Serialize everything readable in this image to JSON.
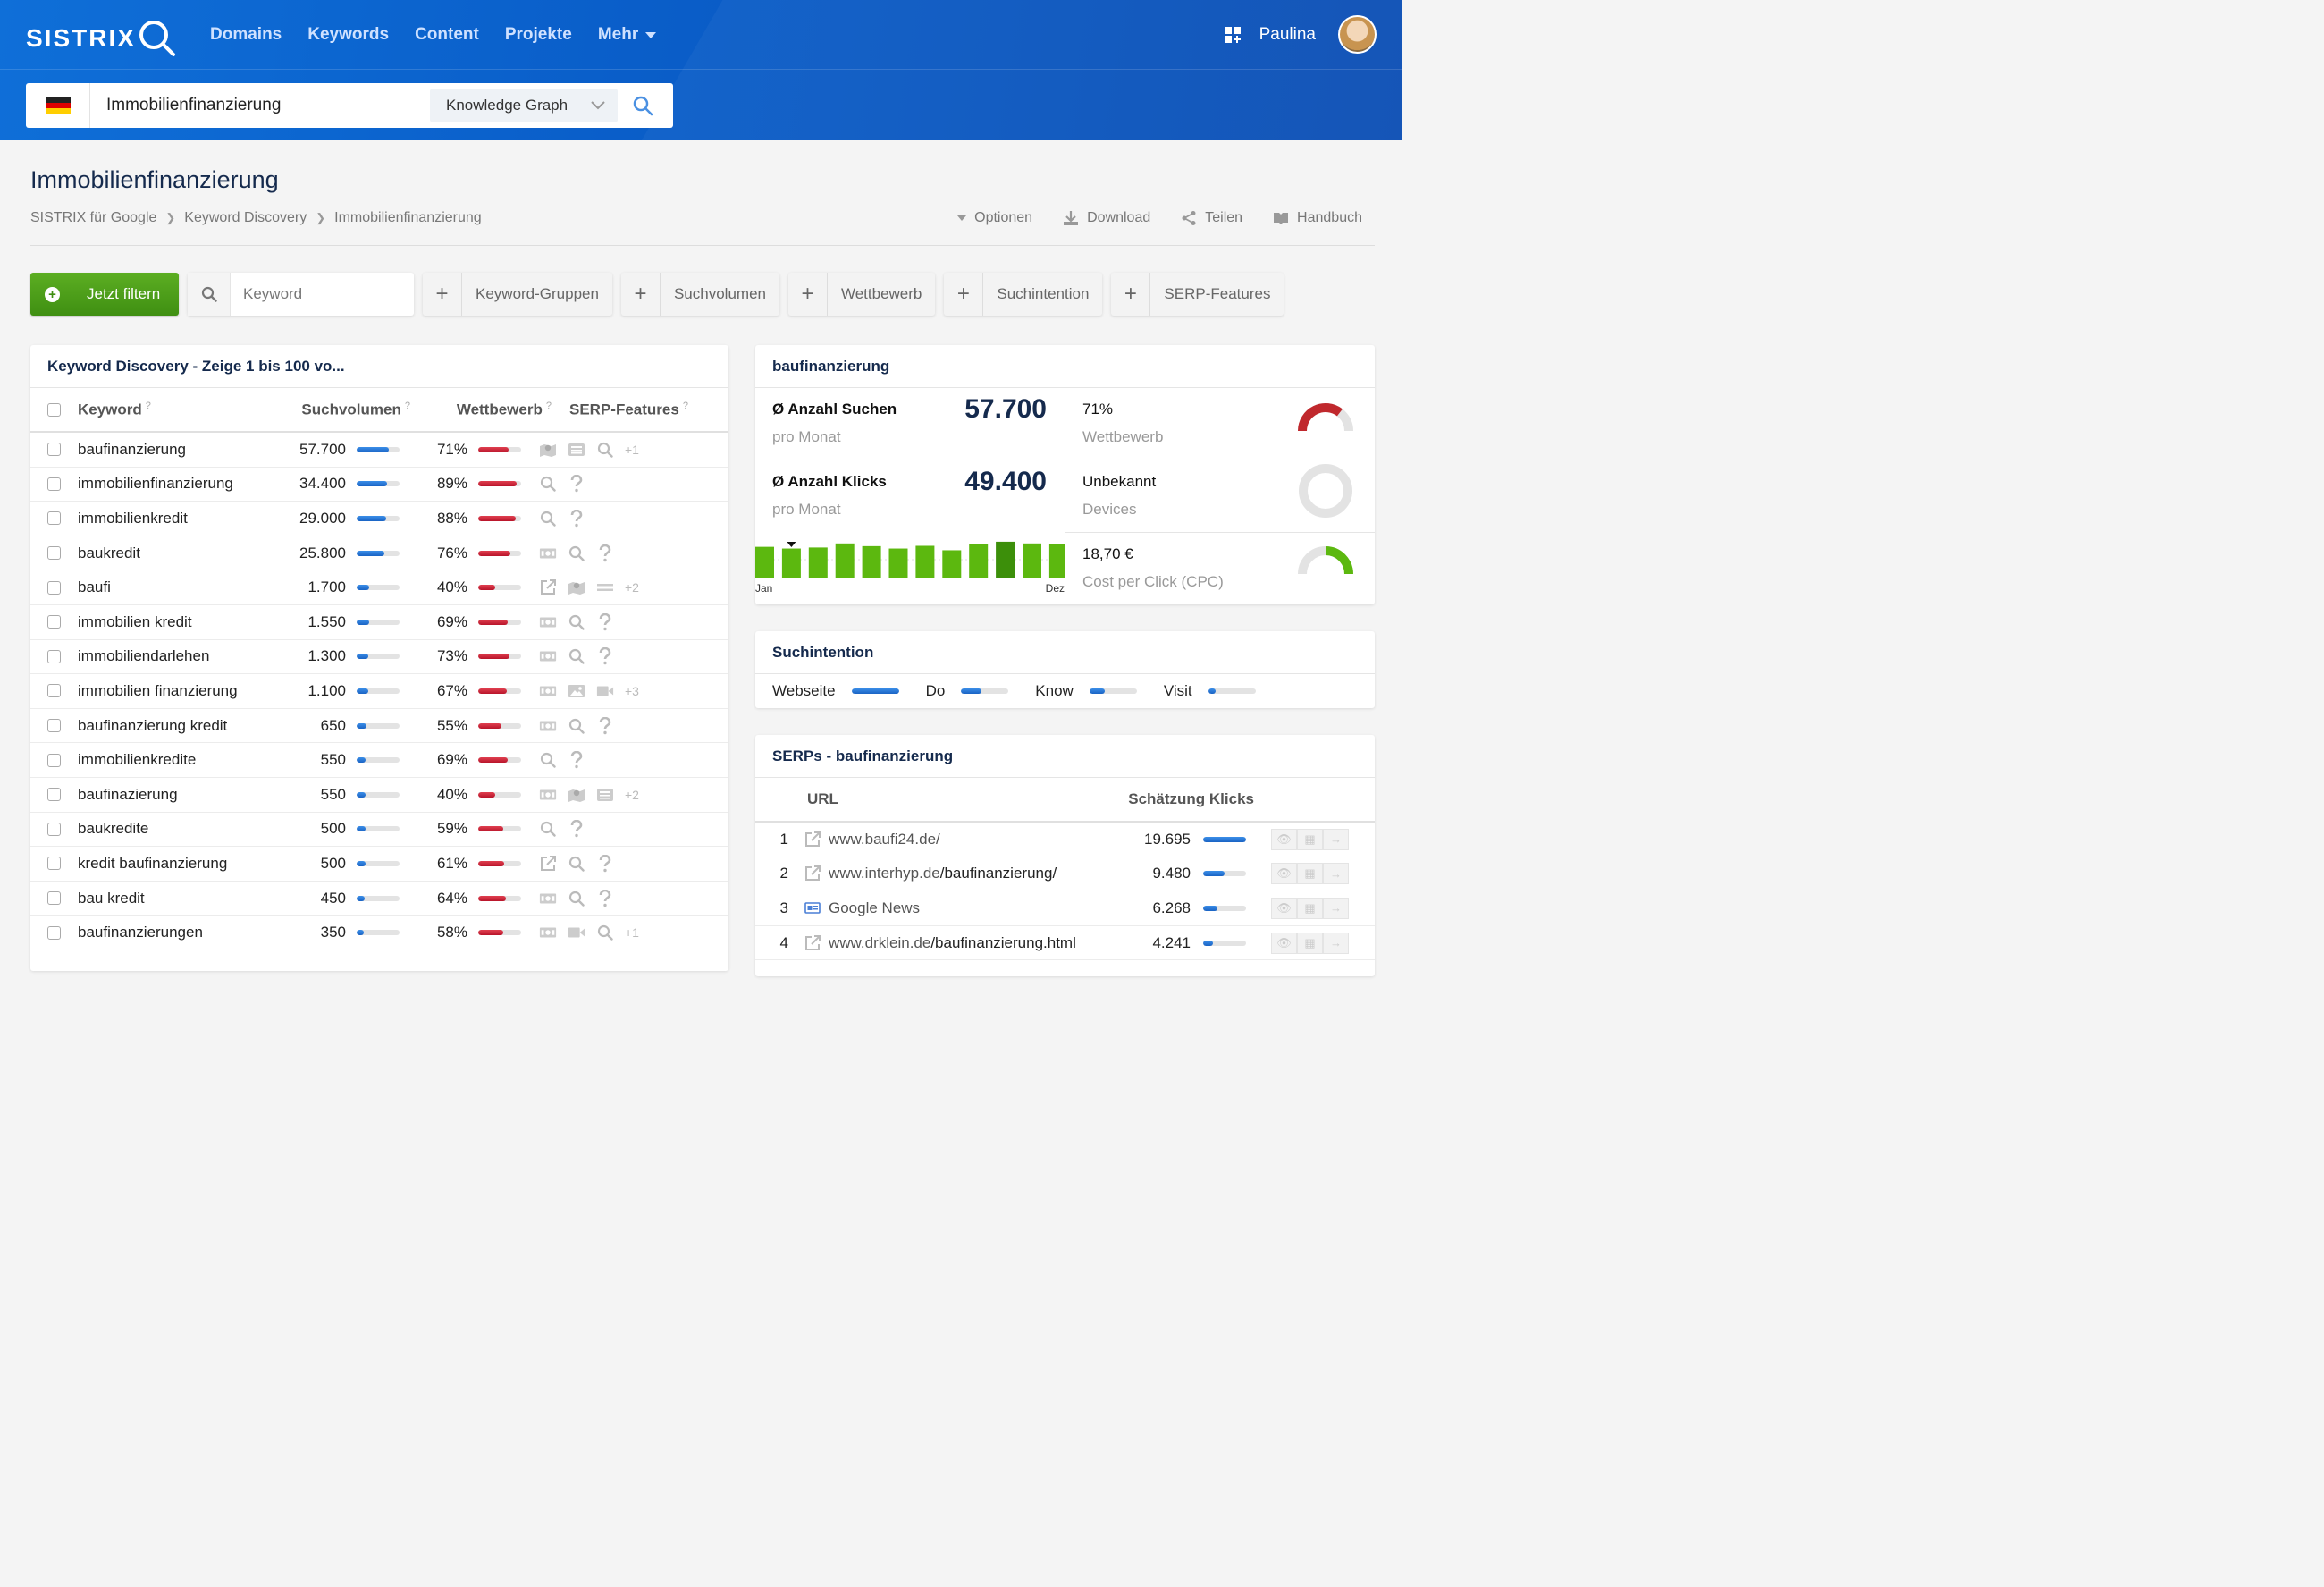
{
  "header": {
    "logo": "SISTRIX",
    "nav": [
      "Domains",
      "Keywords",
      "Content",
      "Projekte"
    ],
    "nav_more": "Mehr",
    "user": "Paulina"
  },
  "search": {
    "value": "Immobilienfinanzierung",
    "mode": "Knowledge Graph"
  },
  "page": {
    "title": "Immobilienfinanzierung",
    "breadcrumb": [
      "SISTRIX für Google",
      "Keyword Discovery",
      "Immobilienfinanzierung"
    ],
    "actions": {
      "options": "Optionen",
      "download": "Download",
      "share": "Teilen",
      "manual": "Handbuch"
    }
  },
  "filters": {
    "main": "Jetzt filtern",
    "keyword_placeholder": "Keyword",
    "chips": [
      "Keyword-Gruppen",
      "Suchvolumen",
      "Wettbewerb",
      "Suchintention",
      "SERP-Features"
    ]
  },
  "table": {
    "title": "Keyword Discovery - Zeige 1 bis 100 vo...",
    "headers": {
      "keyword": "Keyword",
      "volume": "Suchvolumen",
      "competition": "Wettbewerb",
      "serp": "SERP-Features"
    },
    "help": "?",
    "rows": [
      {
        "keyword": "baufinanzierung",
        "volume": "57.700",
        "vol_pct": 0.75,
        "competition": "71%",
        "comp_pct": 0.71,
        "serp": [
          "map-icon",
          "news-icon",
          "search-icon"
        ],
        "more": "+1"
      },
      {
        "keyword": "immobilienfinanzierung",
        "volume": "34.400",
        "vol_pct": 0.7,
        "competition": "89%",
        "comp_pct": 0.89,
        "serp": [
          "search-icon",
          "question-icon"
        ],
        "more": ""
      },
      {
        "keyword": "immobilienkredit",
        "volume": "29.000",
        "vol_pct": 0.68,
        "competition": "88%",
        "comp_pct": 0.88,
        "serp": [
          "search-icon",
          "question-icon"
        ],
        "more": ""
      },
      {
        "keyword": "baukredit",
        "volume": "25.800",
        "vol_pct": 0.65,
        "competition": "76%",
        "comp_pct": 0.76,
        "serp": [
          "ads-icon",
          "search-icon",
          "question-icon"
        ],
        "more": ""
      },
      {
        "keyword": "baufi",
        "volume": "1.700",
        "vol_pct": 0.3,
        "competition": "40%",
        "comp_pct": 0.4,
        "serp": [
          "external-link-icon",
          "map-icon",
          "equals-icon"
        ],
        "more": "+2"
      },
      {
        "keyword": "immobilien kredit",
        "volume": "1.550",
        "vol_pct": 0.3,
        "competition": "69%",
        "comp_pct": 0.69,
        "serp": [
          "ads-icon",
          "search-icon",
          "question-icon"
        ],
        "more": ""
      },
      {
        "keyword": "immobiliendarlehen",
        "volume": "1.300",
        "vol_pct": 0.28,
        "competition": "73%",
        "comp_pct": 0.73,
        "serp": [
          "ads-icon",
          "search-icon",
          "question-icon"
        ],
        "more": ""
      },
      {
        "keyword": "immobilien finanzierung",
        "volume": "1.100",
        "vol_pct": 0.27,
        "competition": "67%",
        "comp_pct": 0.67,
        "serp": [
          "ads-icon",
          "image-icon",
          "video-icon"
        ],
        "more": "+3"
      },
      {
        "keyword": "baufinanzierung kredit",
        "volume": "650",
        "vol_pct": 0.22,
        "competition": "55%",
        "comp_pct": 0.55,
        "serp": [
          "ads-icon",
          "search-icon",
          "question-icon"
        ],
        "more": ""
      },
      {
        "keyword": "immobilienkredite",
        "volume": "550",
        "vol_pct": 0.2,
        "competition": "69%",
        "comp_pct": 0.69,
        "serp": [
          "search-icon",
          "question-icon"
        ],
        "more": ""
      },
      {
        "keyword": "baufinazierung",
        "volume": "550",
        "vol_pct": 0.2,
        "competition": "40%",
        "comp_pct": 0.4,
        "serp": [
          "ads-icon",
          "map-icon",
          "news-icon"
        ],
        "more": "+2"
      },
      {
        "keyword": "baukredite",
        "volume": "500",
        "vol_pct": 0.2,
        "competition": "59%",
        "comp_pct": 0.59,
        "serp": [
          "search-icon",
          "question-icon"
        ],
        "more": ""
      },
      {
        "keyword": "kredit baufinanzierung",
        "volume": "500",
        "vol_pct": 0.2,
        "competition": "61%",
        "comp_pct": 0.61,
        "serp": [
          "external-link-icon",
          "search-icon",
          "question-icon"
        ],
        "more": ""
      },
      {
        "keyword": "bau kredit",
        "volume": "450",
        "vol_pct": 0.18,
        "competition": "64%",
        "comp_pct": 0.64,
        "serp": [
          "ads-icon",
          "search-icon",
          "question-icon"
        ],
        "more": ""
      },
      {
        "keyword": "baufinanzierungen",
        "volume": "350",
        "vol_pct": 0.16,
        "competition": "58%",
        "comp_pct": 0.58,
        "serp": [
          "ads-icon",
          "video-icon",
          "search-icon"
        ],
        "more": "+1"
      }
    ]
  },
  "detail": {
    "title": "baufinanzierung",
    "searches_label": "Ø Anzahl Suchen",
    "searches_sub": "pro Monat",
    "searches_value": "57.700",
    "clicks_label": "Ø Anzahl Klicks",
    "clicks_sub": "pro Monat",
    "clicks_value": "49.400",
    "competition_value": "71%",
    "competition_label": "Wettbewerb",
    "competition_level": 0.71,
    "devices_value": "Unbekannt",
    "devices_label": "Devices",
    "cpc_value": "18,70 €",
    "cpc_label": "Cost per Click (CPC)",
    "cpc_level": 0.5,
    "trend_start": "Jan",
    "trend_end": "Dez",
    "colors": {
      "bar": "#5cb80f",
      "bar_dark": "#3c8f0a",
      "gauge_red": "#c0282d",
      "gauge_green": "#5cb80f"
    }
  },
  "chart_data": {
    "type": "bar",
    "categories": [
      "Jan",
      "",
      "",
      "",
      "",
      "",
      "",
      "",
      "",
      "",
      "",
      "Dez"
    ],
    "values": [
      0.9,
      0.85,
      0.88,
      1.0,
      0.92,
      0.85,
      0.93,
      0.8,
      0.98,
      1.05,
      1.0,
      0.97
    ],
    "highlight_index": 9,
    "marker_index": 1
  },
  "intent": {
    "title": "Suchintention",
    "items": [
      {
        "label": "Webseite",
        "pct": 1.0
      },
      {
        "label": "Do",
        "pct": 0.42
      },
      {
        "label": "Know",
        "pct": 0.33
      },
      {
        "label": "Visit",
        "pct": 0.15
      }
    ]
  },
  "serps": {
    "title": "SERPs - baufinanzierung",
    "headers": {
      "url": "URL",
      "clicks": "Schätzung Klicks"
    },
    "rows": [
      {
        "pos": "1",
        "domain": "www.baufi24.de/",
        "path": "",
        "icon": "external-link-icon",
        "clicks": "19.695",
        "pct": 1.0
      },
      {
        "pos": "2",
        "domain": "www.interhyp.de",
        "path": "/baufinanzierung/",
        "icon": "external-link-icon",
        "clicks": "9.480",
        "pct": 0.5
      },
      {
        "pos": "3",
        "domain": "Google News",
        "path": "",
        "icon": "google-news-icon",
        "clicks": "6.268",
        "pct": 0.33
      },
      {
        "pos": "4",
        "domain": "www.drklein.de",
        "path": "/baufinanzierung.html",
        "icon": "external-link-icon",
        "clicks": "4.241",
        "pct": 0.22
      }
    ]
  }
}
